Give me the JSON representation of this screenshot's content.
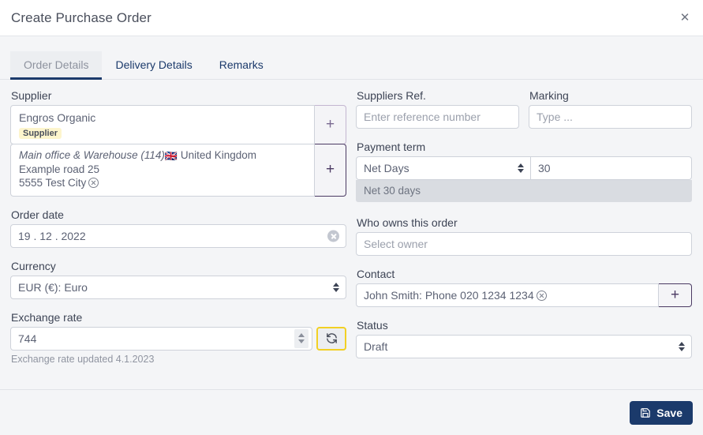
{
  "header": {
    "title": "Create Purchase Order",
    "close_label": "✕"
  },
  "tabs": [
    {
      "label": "Order Details",
      "active": true
    },
    {
      "label": "Delivery Details",
      "active": false
    },
    {
      "label": "Remarks",
      "active": false
    }
  ],
  "left": {
    "supplier": {
      "label": "Supplier",
      "name": "Engros Organic",
      "badge": "Supplier",
      "add_label": "+",
      "address": {
        "office": "Main office & Warehouse (114)",
        "flag": "🇬🇧",
        "country": "United Kingdom",
        "street": "Example road 25",
        "city": "5555 Test City",
        "add_label": "+"
      }
    },
    "order_date": {
      "label": "Order date",
      "value": "19 . 12 . 2022"
    },
    "currency": {
      "label": "Currency",
      "value": "EUR (€): Euro"
    },
    "exchange_rate": {
      "label": "Exchange rate",
      "value": "744",
      "hint": "Exchange rate updated 4.1.2023"
    }
  },
  "right": {
    "suppliers_ref": {
      "label": "Suppliers Ref.",
      "value": "",
      "placeholder": "Enter reference number"
    },
    "marking": {
      "label": "Marking",
      "value": "",
      "placeholder": "Type ..."
    },
    "payment_term": {
      "label": "Payment term",
      "type_value": "Net Days",
      "days_value": "30",
      "hint": "Net 30 days"
    },
    "owner": {
      "label": "Who owns this order",
      "value": "",
      "placeholder": "Select owner"
    },
    "contact": {
      "label": "Contact",
      "value": "John Smith: Phone 020 1234 1234",
      "add_label": "+"
    },
    "status": {
      "label": "Status",
      "value": "Draft"
    }
  },
  "footer": {
    "save_label": "Save"
  },
  "colors": {
    "accent_navy": "#1b3a6b",
    "purple_border": "#4b3a63",
    "badge_yellow": "#fdf5cd",
    "refresh_yellow": "#f2d024",
    "body_bg": "#f4f5f7"
  }
}
